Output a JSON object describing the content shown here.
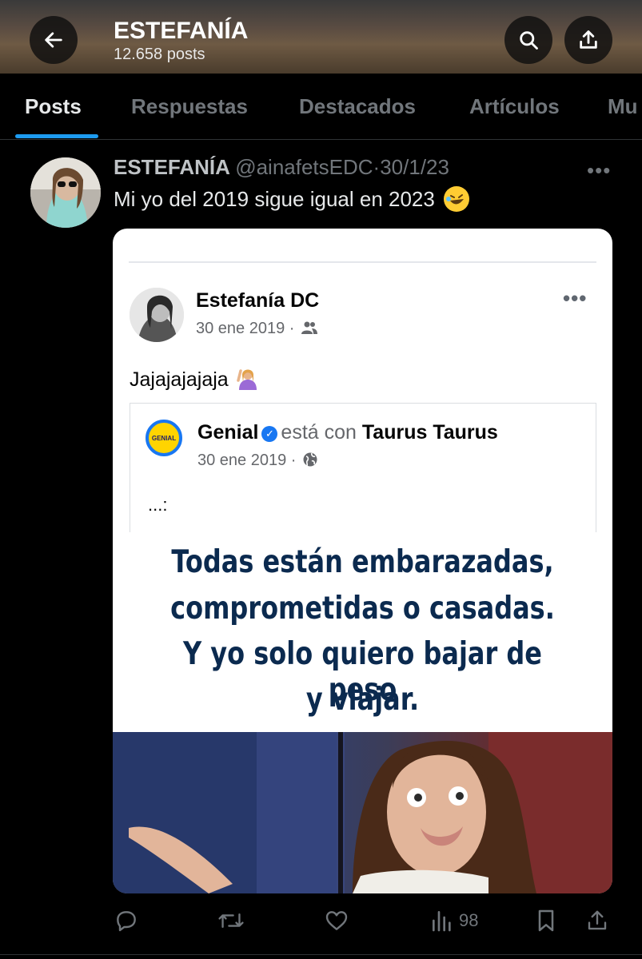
{
  "header": {
    "title": "ESTEFANÍA",
    "subtitle": "12.658 posts",
    "back_icon": "arrow-left-icon",
    "search_icon": "search-icon",
    "share_icon": "share-icon"
  },
  "tabs": [
    {
      "label": "Posts",
      "active": true
    },
    {
      "label": "Respuestas",
      "active": false
    },
    {
      "label": "Destacados",
      "active": false
    },
    {
      "label": "Artículos",
      "active": false
    },
    {
      "label": "Mu",
      "active": false
    }
  ],
  "tweet": {
    "display_name": "ESTEFANÍA",
    "handle": "@ainafetsEDC",
    "separator": "·",
    "date": "30/1/23",
    "more": "•••",
    "text": "Mi yo del 2019 sigue igual en 2023",
    "emoji": "rolling-on-floor-laughing-emoji"
  },
  "embedded": {
    "author": "Estefanía DC",
    "date": "30 ene 2019 ·",
    "audience_icon": "friends-icon",
    "more": "•••",
    "text": "Jajajajajaja",
    "emoji": "person-raising-hand-emoji",
    "shared": {
      "logo_text": "GENIAL",
      "page": "Genial",
      "with_text": "está con",
      "tagged": "Taurus Taurus",
      "date": "30 ene 2019 ·",
      "audience_icon": "globe-icon",
      "text": "...:"
    },
    "meme_lines": [
      "Todas están embarazadas,",
      "comprometidas o casadas.",
      "Y yo solo quiero bajar de peso",
      "y viajar."
    ]
  },
  "actions": {
    "reply_icon": "reply-icon",
    "repost_icon": "repost-icon",
    "like_icon": "heart-icon",
    "views_icon": "views-icon",
    "views_count": "98",
    "bookmark_icon": "bookmark-icon",
    "share_icon": "share-icon"
  },
  "colors": {
    "background": "#000000",
    "accent": "#1d9bf0",
    "muted": "#71767b",
    "meme_text": "#0b2a4f"
  }
}
